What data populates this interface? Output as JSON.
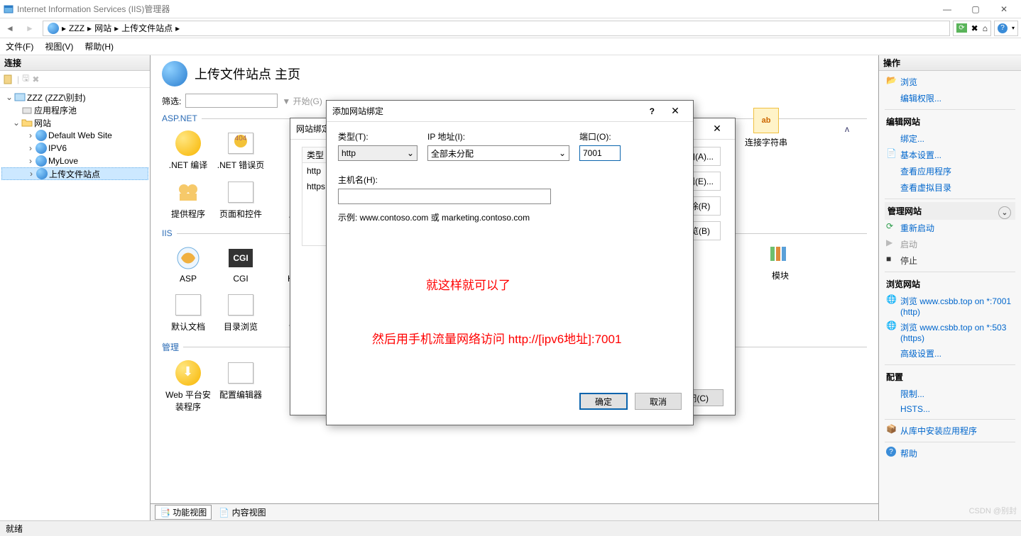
{
  "window_title": "Internet Information Services (IIS)管理器",
  "breadcrumb": [
    "ZZZ",
    "网站",
    "上传文件站点"
  ],
  "menu": {
    "file": "文件(F)",
    "view": "视图(V)",
    "help": "帮助(H)"
  },
  "left": {
    "header": "连接",
    "root": "ZZZ (ZZZ\\别封)",
    "pool": "应用程序池",
    "sites": "网站",
    "site1": "Default Web Site",
    "site2": "IPV6",
    "site3": "MyLove",
    "site4": "上传文件站点"
  },
  "center": {
    "title": "上传文件站点 主页",
    "filter_label": "筛选:",
    "start": "开始(G)",
    "group_asp": "ASP.NET",
    "group_iis": "IIS",
    "group_mgmt": "管理",
    "features": {
      "net_compile": ".NET 编译",
      "net_error": ".NET 错误页",
      "net_other": ".N",
      "providers": "提供程序",
      "page_ctrl": "页面和控件",
      "app": "应",
      "asp": "ASP",
      "cgi": "CGI",
      "ht": "HT",
      "def_doc": "默认文档",
      "dir_browse": "目录浏览",
      "req": "请",
      "web_plat": "Web 平台安装程序",
      "cfg_editor": "配置编辑器",
      "conn_str": "连接字符串",
      "modules": "模块"
    },
    "tabs": {
      "features": "功能视图",
      "content": "内容视图"
    }
  },
  "right": {
    "header": "操作",
    "browse": "浏览",
    "edit_perm": "编辑权限...",
    "edit_site": "编辑网站",
    "binding": "绑定...",
    "basic": "基本设置...",
    "view_app": "查看应用程序",
    "view_vdir": "查看虚拟目录",
    "manage_site": "管理网站",
    "restart": "重新启动",
    "start": "启动",
    "stop": "停止",
    "browse_site": "浏览网站",
    "browse1": "浏览 www.csbb.top on *:7001 (http)",
    "browse2": "浏览 www.csbb.top on *:503 (https)",
    "adv": "高级设置...",
    "config": "配置",
    "limit": "限制...",
    "hsts": "HSTS...",
    "from_gal": "从库中安装应用程序",
    "help": "帮助"
  },
  "back_dialog": {
    "title": "网站绑定",
    "col_type": "类型",
    "r1": "http",
    "r2": "https",
    "btn_add": "添加(A)...",
    "btn_edit": "编辑(E)...",
    "btn_del": "删除(R)",
    "btn_browse": "浏览(B)",
    "close": "关闭(C)"
  },
  "add_dialog": {
    "title": "添加网站绑定",
    "type_label": "类型(T):",
    "type_value": "http",
    "ip_label": "IP 地址(I):",
    "ip_value": "全部未分配",
    "port_label": "端口(O):",
    "port_value": "7001",
    "host_label": "主机名(H):",
    "example": "示例: www.contoso.com 或 marketing.contoso.com",
    "ok": "确定",
    "cancel": "取消"
  },
  "annotations": {
    "a1": "就这样就可以了",
    "a2": "然后用手机流量网络访问 http://[ipv6地址]:7001"
  },
  "status": "就绪",
  "watermark": "CSDN @别封"
}
